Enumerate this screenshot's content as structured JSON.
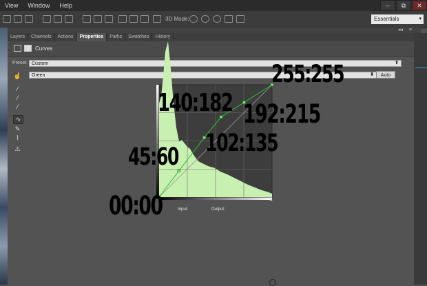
{
  "menubar": {
    "items": [
      "View",
      "Window",
      "Help"
    ],
    "window_buttons": [
      "–",
      "⧉",
      "✕"
    ]
  },
  "options_bar": {
    "mode_label": "3D Mode:",
    "workspace": "Essentials"
  },
  "panel": {
    "tabs": [
      "Layers",
      "Channels",
      "Actions",
      "Properties",
      "Paths",
      "Swatches",
      "History"
    ],
    "active_tab": "Properties",
    "title": "Curves",
    "preset_label": "Preset:",
    "preset_value": "Custom",
    "channel_value": "Green",
    "auto_label": "Auto",
    "input_label": "Input:",
    "output_label": "Output:",
    "collapse_glyphs": [
      "◂◂",
      "≡"
    ]
  },
  "tools": [
    {
      "icon": "on-image-adjust-icon",
      "glyph": "☝"
    },
    {
      "icon": "black-eyedropper-icon",
      "glyph": "⁄"
    },
    {
      "icon": "gray-eyedropper-icon",
      "glyph": "⁄"
    },
    {
      "icon": "white-eyedropper-icon",
      "glyph": "⁄"
    },
    {
      "icon": "curve-smooth-icon",
      "glyph": "∿"
    },
    {
      "icon": "pencil-icon",
      "glyph": "✎"
    },
    {
      "icon": "smooth-icon",
      "glyph": "⌇"
    },
    {
      "icon": "clipping-warning-icon",
      "glyph": "⚠"
    }
  ],
  "chart_data": {
    "type": "line",
    "title": "",
    "channel": "Green",
    "xlim": [
      0,
      255
    ],
    "ylim": [
      0,
      255
    ],
    "grid": true,
    "series": [
      {
        "values": [
          [
            0,
            0
          ],
          [
            45,
            60
          ],
          [
            102,
            135
          ],
          [
            140,
            182
          ],
          [
            192,
            215
          ],
          [
            255,
            255
          ]
        ]
      }
    ],
    "annotations": [
      "00:00",
      "45:60",
      "102:135",
      "140:182",
      "192:215",
      "255:255"
    ]
  },
  "colors": {
    "histogram": "#c8f0b0",
    "curve": "#2fbf2f",
    "background": "#535353"
  }
}
